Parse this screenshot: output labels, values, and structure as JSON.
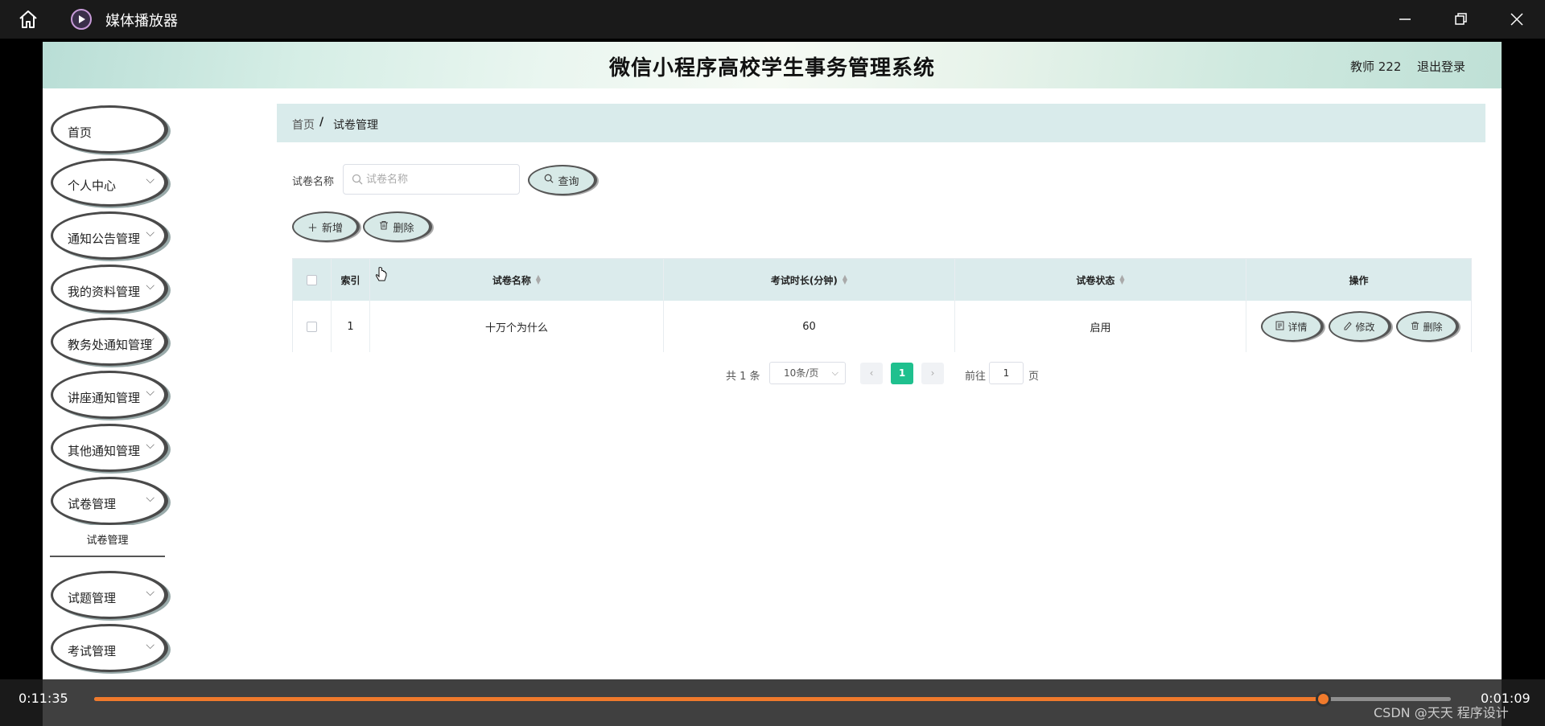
{
  "player": {
    "title": "媒体播放器",
    "elapsed": "0:11:35",
    "remaining": "0:01:09",
    "progress": 0.906,
    "watermark": "CSDN @天天 程序设计",
    "colors": {
      "accent": "#f07a2c",
      "titlebar": "#1a1a1a"
    }
  },
  "header": {
    "title": "微信小程序高校学生事务管理系统",
    "user": "教师 222",
    "logout": "退出登录"
  },
  "sidebar": {
    "items": [
      {
        "label": "首页",
        "has_chevron": false
      },
      {
        "label": "个人中心",
        "has_chevron": true
      },
      {
        "label": "通知公告管理",
        "has_chevron": true
      },
      {
        "label": "我的资料管理",
        "has_chevron": true
      },
      {
        "label": "教务处通知管理",
        "has_chevron": true
      },
      {
        "label": "讲座通知管理",
        "has_chevron": true
      },
      {
        "label": "其他通知管理",
        "has_chevron": true
      },
      {
        "label": "试卷管理",
        "has_chevron": true
      },
      {
        "label": "试题管理",
        "has_chevron": true
      },
      {
        "label": "考试管理",
        "has_chevron": true
      }
    ],
    "submenu": "试卷管理"
  },
  "breadcrumb": {
    "home": "首页",
    "separator": "/",
    "current": "试卷管理"
  },
  "search": {
    "label": "试卷名称",
    "placeholder": "试卷名称",
    "query_button": "查询"
  },
  "toolbar": {
    "add": "新增",
    "delete": "删除"
  },
  "table": {
    "columns": [
      "索引",
      "试卷名称",
      "考试时长(分钟)",
      "试卷状态",
      "操作"
    ],
    "rows": [
      {
        "index": "1",
        "name": "十万个为什么",
        "duration": "60",
        "status": "启用"
      }
    ],
    "actions": [
      "详情",
      "修改",
      "删除"
    ]
  },
  "pagination": {
    "total": "共 1 条",
    "page_size": "10条/页",
    "current_page": "1",
    "goto_label": "前往",
    "goto_value": "1",
    "page_unit": "页"
  },
  "colors": {
    "primary": "#1fc08e",
    "header_bg": "#dbebec",
    "pill_bg": "#d7e9e7"
  }
}
